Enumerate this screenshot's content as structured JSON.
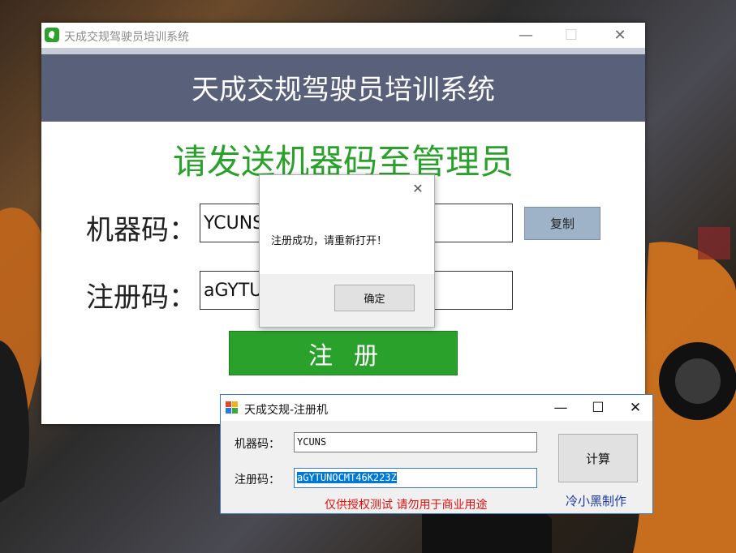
{
  "main_window": {
    "title": "天成交规驾驶员培训系统",
    "header": "天成交规驾驶员培训系统",
    "subtitle": "请发送机器码至管理员",
    "machine_label": "机器码：",
    "machine_value": "YCUNS",
    "reg_label": "注册码：",
    "reg_value": "aGYTU",
    "copy_button": "复制",
    "register_button": "注册",
    "minimize": "—",
    "maximize": "☐",
    "close": "✕"
  },
  "message_box": {
    "text": "注册成功，请重新打开！",
    "ok_button": "确定",
    "close": "✕"
  },
  "keygen": {
    "title": "天成交规-注册机",
    "machine_label": "机器码：",
    "machine_value": "YCUNS",
    "reg_label": "注册码：",
    "reg_value": "aGYTUNOCMT46K223Z",
    "calc_button": "计算",
    "warning": "仅供授权测试 请勿用于商业用途",
    "author": "冷小黑制作",
    "minimize": "—",
    "maximize": "☐",
    "close": "✕"
  },
  "colors": {
    "accent_green": "#2aa12a",
    "header_slate": "#59617a",
    "copy_button": "#9fb3c8",
    "warning_red": "#e01010",
    "author_blue": "#1a3aa8"
  }
}
